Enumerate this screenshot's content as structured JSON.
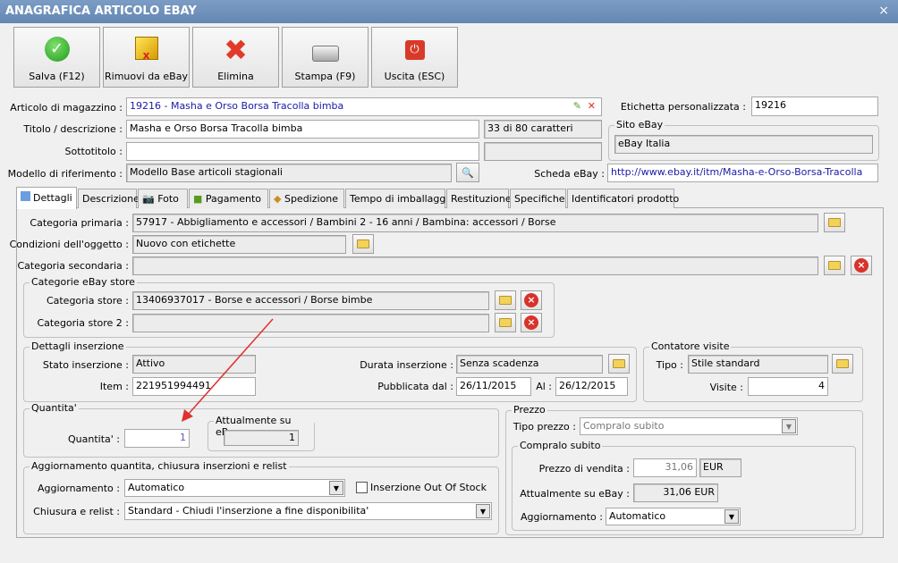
{
  "window": {
    "title": "ANAGRAFICA ARTICOLO EBAY",
    "close": "×"
  },
  "toolbar": [
    {
      "label": "Salva (F12)",
      "icon": "check-icon"
    },
    {
      "label": "Rimuovi da eBay",
      "icon": "box-remove-icon"
    },
    {
      "label": "Elimina",
      "icon": "red-x-icon"
    },
    {
      "label": "Stampa (F9)",
      "icon": "printer-icon"
    },
    {
      "label": "Uscita (ESC)",
      "icon": "power-icon"
    }
  ],
  "form": {
    "articolo_label": "Articolo di magazzino :",
    "articolo_value": "19216 - Masha e Orso Borsa Tracolla bimba",
    "etichetta_label": "Etichetta personalizzata :",
    "etichetta_value": "19216",
    "titolo_label": "Titolo / descrizione :",
    "titolo_value": "Masha e Orso Borsa Tracolla bimba",
    "titolo_count": "33 di 80 caratteri",
    "sito_label": "Sito eBay",
    "sito_value": "eBay Italia",
    "sottotitolo_label": "Sottotitolo :",
    "sottotitolo_value": "",
    "modello_label": "Modello di riferimento :",
    "modello_value": "Modello Base articoli stagionali",
    "scheda_label": "Scheda eBay :",
    "scheda_value": "http://www.ebay.it/itm/Masha-e-Orso-Borsa-Tracolla"
  },
  "tabs": [
    "Dettagli",
    "Descrizione",
    "Foto",
    "Pagamento",
    "Spedizione",
    "Tempo di imballaggio",
    "Restituzione",
    "Specifiche",
    "Identificatori prodotto"
  ],
  "dettagli": {
    "cat_primaria_label": "Categoria primaria :",
    "cat_primaria": "57917 - Abbigliamento e accessori / Bambini 2 - 16 anni / Bambina: accessori / Borse",
    "condizioni_label": "Condizioni dell'oggetto :",
    "condizioni": "Nuovo con etichette",
    "cat_secondaria_label": "Categoria secondaria :",
    "cat_secondaria": "",
    "store_group": "Categorie eBay store",
    "store1_label": "Categoria store :",
    "store1": "13406937017 - Borse e accessori / Borse bimbe",
    "store2_label": "Categoria store 2 :",
    "store2": "",
    "ins_group": "Dettagli inserzione",
    "stato_label": "Stato inserzione :",
    "stato": "Attivo",
    "item_label": "Item :",
    "item": "221951994491",
    "durata_label": "Durata inserzione :",
    "durata": "Senza scadenza",
    "pubblicata_label": "Pubblicata dal :",
    "pubblicata": "26/11/2015",
    "al_label": "Al :",
    "al": "26/12/2015",
    "visite_group": "Contatore visite",
    "tipo_label": "Tipo :",
    "tipo": "Stile standard",
    "visite_label": "Visite :",
    "visite": "4",
    "qta_group": "Quantita'",
    "qta_label": "Quantita' :",
    "qta": "1",
    "att_group": "Attualmente su eBay",
    "att": "1",
    "agg_group": "Aggiornamento quantita, chiusura inserzioni e relist",
    "agg_label": "Aggiornamento :",
    "agg": "Automatico",
    "oos_label": "Inserzione Out Of Stock",
    "chiusura_label": "Chiusura e relist :",
    "chiusura": "Standard - Chiudi l'inserzione a fine disponibilita'",
    "prezzo_group": "Prezzo",
    "tipo_prezzo_label": "Tipo prezzo :",
    "tipo_prezzo": "Compralo subito",
    "cs_group": "Compralo subito",
    "pv_label": "Prezzo di vendita :",
    "pv": "31,06",
    "valuta": "EUR",
    "att_prezzo_label": "Attualmente su eBay :",
    "att_prezzo": "31,06 EUR",
    "agg_prezzo_label": "Aggiornamento :",
    "agg_prezzo": "Automatico"
  },
  "colors": {
    "title_bar": "#6f8fba",
    "link": "#1a1aa6",
    "arrow": "#e03030"
  }
}
